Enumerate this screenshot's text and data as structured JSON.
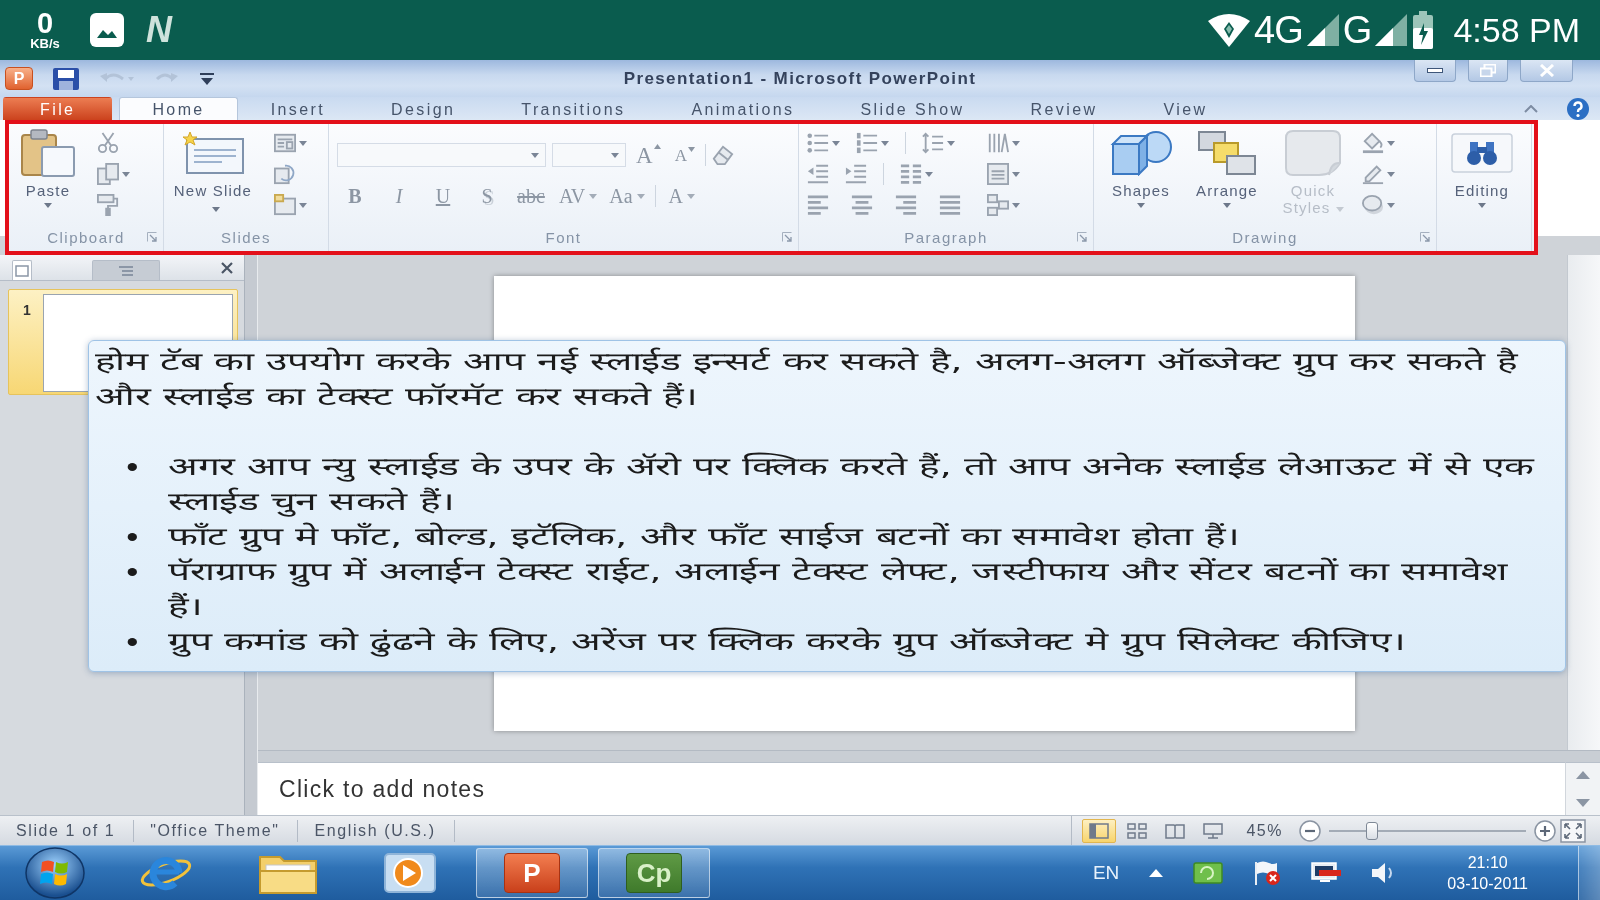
{
  "phone_status_bar": {
    "data_rate": "0",
    "data_rate_unit": "KB/s",
    "notifications": [
      {
        "kind": "gallery"
      },
      {
        "kind": "letter",
        "letter": "N"
      }
    ],
    "networks": [
      {
        "label": "4G"
      },
      {
        "label": "G"
      }
    ],
    "time": "4:58 PM"
  },
  "title_bar": {
    "app_logo": "P",
    "quick_access": [
      {
        "kind": "save",
        "disabled": false
      },
      {
        "kind": "undo",
        "disabled": true
      },
      {
        "kind": "redo",
        "disabled": true
      },
      {
        "kind": "customize",
        "disabled": false
      }
    ],
    "title": "Presentation1 - Microsoft PowerPoint"
  },
  "ribbon_tabs": [
    {
      "label": "File",
      "kind": "backstage",
      "selected": false
    },
    {
      "label": "Home",
      "kind": "tab",
      "selected": true
    },
    {
      "label": "Insert",
      "kind": "tab",
      "selected": false
    },
    {
      "label": "Design",
      "kind": "tab",
      "selected": false
    },
    {
      "label": "Transitions",
      "kind": "tab",
      "selected": false
    },
    {
      "label": "Animations",
      "kind": "tab",
      "selected": false
    },
    {
      "label": "Slide Show",
      "kind": "tab",
      "selected": false
    },
    {
      "label": "Review",
      "kind": "tab",
      "selected": false
    },
    {
      "label": "View",
      "kind": "tab",
      "selected": false
    }
  ],
  "ribbon": {
    "highlighted": true,
    "groups": [
      {
        "kind": "clipboard",
        "label": "Clipboard",
        "launcher": true,
        "large_buttons": [
          {
            "kind": "paste",
            "label": "Paste",
            "menu": true,
            "disabled": false
          }
        ]
      },
      {
        "kind": "slides",
        "label": "Slides",
        "large_buttons": [
          {
            "kind": "new_slide",
            "label": "New Slide",
            "menu": true,
            "disabled": false
          }
        ]
      },
      {
        "kind": "font",
        "label": "Font",
        "launcher": true,
        "size_buttons": [
          {
            "kind": "grow",
            "glyph": "A"
          },
          {
            "kind": "shrink",
            "glyph": "A"
          }
        ],
        "format_buttons": [
          {
            "kind": "bold",
            "glyph": "B",
            "menu": false
          },
          {
            "kind": "italic",
            "glyph": "I",
            "menu": false
          },
          {
            "kind": "underline",
            "glyph": "U",
            "menu": false
          },
          {
            "kind": "shadow",
            "glyph": "S",
            "menu": false
          },
          {
            "kind": "strike",
            "glyph": "abc",
            "menu": false
          },
          {
            "kind": "spacing",
            "glyph": "AV",
            "menu": true
          },
          {
            "kind": "case",
            "glyph": "Aa",
            "menu": true
          },
          {
            "kind": "color",
            "glyph": "A",
            "menu": true
          }
        ]
      },
      {
        "kind": "paragraph",
        "label": "Paragraph",
        "launcher": true
      },
      {
        "kind": "drawing",
        "label": "Drawing",
        "launcher": true,
        "large_buttons": [
          {
            "kind": "shapes",
            "label": "Shapes",
            "menu": true,
            "disabled": false
          },
          {
            "kind": "arrange",
            "label": "Arrange",
            "menu": true,
            "disabled": false
          },
          {
            "kind": "quick_styles",
            "label": "Quick Styles",
            "menu": true,
            "disabled": true
          }
        ]
      },
      {
        "kind": "editing",
        "large_buttons": [
          {
            "kind": "editing",
            "label": "Editing",
            "menu": true,
            "disabled": false
          }
        ]
      }
    ]
  },
  "slide_panel": {
    "tabs": [
      {
        "kind": "slides",
        "selected": true
      },
      {
        "kind": "outline",
        "selected": false
      }
    ],
    "slides": [
      {
        "number": "1",
        "selected": true
      }
    ]
  },
  "callout": {
    "intro": "होम टॅब का उपयोग करके आप नई स्लाईड इन्सर्ट कर सकते है, अलग-अलग ऑब्जेक्ट ग्रुप कर सकते है और स्लाईड का टेक्स्ट फॉरमॅट कर सकते हैं।",
    "bullets": [
      "अगर आप न्यु स्लाईड के उपर के ॲरो पर क्लिक करते हैं, तो आप अनेक स्लाईड लेआऊट में से एक स्लाईड चुन सकते हैं।",
      "फॉंट ग्रुप मे फॉंट, बोल्ड, इटॅलिक, और फॉंट साईज बटनों का समावेश होता हैं।",
      "पॅराग्राफ ग्रुप में अलाईन टेक्स्ट राईट, अलाईन टेक्स्ट लेफ्ट, जस्टीफाय और सेंटर बटनों का समावेश हैं।",
      "ग्रुप कमांड को ढुंढने के लिए, अरेंज पर क्लिक करके ग्रुप ऑब्जेक्ट मे ग्रुप सिलेक्ट कीजिए।"
    ]
  },
  "notes": {
    "placeholder": "Click to add notes"
  },
  "status_bar": {
    "slide_info": "Slide 1 of 1",
    "theme": "\"Office Theme\"",
    "language": "English (U.S.)",
    "views": [
      {
        "kind": "normal",
        "selected": true
      },
      {
        "kind": "sorter",
        "selected": false
      },
      {
        "kind": "reading",
        "selected": false
      },
      {
        "kind": "slideshow",
        "selected": false
      }
    ],
    "zoom": {
      "reading": "45%",
      "level": 0.22
    }
  },
  "taskbar": {
    "apps": [
      {
        "kind": "browser",
        "active": false
      },
      {
        "kind": "files",
        "active": false
      },
      {
        "kind": "media",
        "active": false
      },
      {
        "kind": "presentation",
        "logo": "P",
        "active": true
      },
      {
        "kind": "captivate",
        "logo": "Cp",
        "active": true
      }
    ],
    "tray": {
      "language": "EN",
      "time": "21:10",
      "date": "03-10-2011"
    }
  }
}
